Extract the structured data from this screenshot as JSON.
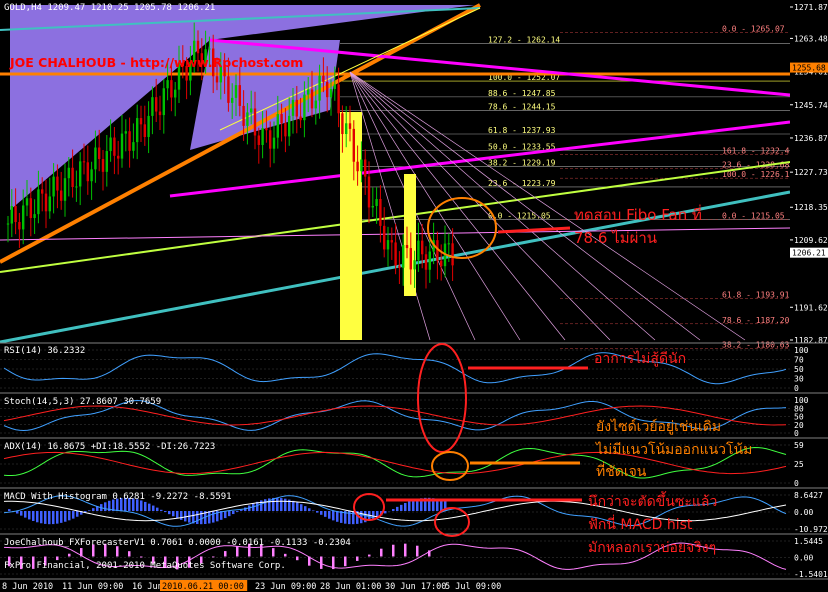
{
  "main": {
    "header": "GOLD,H4  1209.47 1210.25 1205.78 1206.21",
    "watermark": "JOE CHALHOUB - http://www.Rpchost.com",
    "yticks": [
      "1271.87",
      "1263.48",
      "1254.61",
      "1245.74",
      "1236.87",
      "1227.73",
      "1218.35",
      "1209.62",
      "1206.21",
      "1191.62",
      "1182.87"
    ],
    "price_tags": [
      "1255.68",
      "1206.21"
    ],
    "fibo_top": [
      {
        "pct": "127.2",
        "val": "1262.14"
      },
      {
        "pct": "100.0",
        "val": "1252.07"
      },
      {
        "pct": "88.6",
        "val": "1247.85"
      },
      {
        "pct": "78.6",
        "val": "1244.15"
      },
      {
        "pct": "61.8",
        "val": "1237.93"
      },
      {
        "pct": "50.0",
        "val": "1233.55"
      },
      {
        "pct": "38.2",
        "val": "1229.19"
      },
      {
        "pct": "23.6",
        "val": "1223.79"
      },
      {
        "pct": "0.0",
        "val": "1215.05"
      }
    ],
    "fibo_right": [
      {
        "pct": "0.0",
        "val": "1265.07"
      },
      {
        "pct": "161.8",
        "val": "1232.42"
      },
      {
        "pct": "23.6",
        "val": "1228.68"
      },
      {
        "pct": "100.0",
        "val": "1226.12"
      },
      {
        "pct": "0.0",
        "val": "1215.05"
      },
      {
        "pct": "61.8",
        "val": "1193.91"
      },
      {
        "pct": "78.6",
        "val": "1187.20"
      },
      {
        "pct": "38.2",
        "val": "1180.63"
      }
    ],
    "annotation": [
      "ทดสอบ Fibo Fan ที่",
      "78.6 ไม่ผ่าน"
    ],
    "colors": {
      "up": "#00c000",
      "down": "#e00000",
      "orange": "#ff8000",
      "magenta": "#ff00ff",
      "cyan": "#40c0c0",
      "yellow": "#ffff40"
    }
  },
  "rsi": {
    "label": "RSI(14) 36.2332",
    "ticks": [
      "100",
      "70",
      "50",
      "30",
      "0"
    ],
    "note": "อาการไม่สู้ดีนัก"
  },
  "stoch": {
    "label": "Stoch(14,5,3) 27.8607 30.7659",
    "ticks": [
      "100",
      "80",
      "50",
      "20",
      "0"
    ]
  },
  "adx": {
    "label": "ADX(14) 16.8675 +DI:18.5552 -DI:26.7223",
    "ticks": [
      "59",
      "25",
      "0"
    ]
  },
  "note_stoch_adx": [
    "ยังไซด์เวย์อยู่เช่นเดิม",
    "ไม่มีแนวโน้มออกแนวโน้ม",
    "ที่ชัดเจน"
  ],
  "macd": {
    "label": "MACD With Histogram 0.6281 -9.2272 -8.5591",
    "ticks": [
      "8.6427",
      "0.00",
      "-10.9727"
    ],
    "note": [
      "นึกว่าจะตัดขึ้นซะแล้ว",
      "ฟักนี่ MACD hist",
      "มักหลอกเราบ่อยจริงๆ"
    ]
  },
  "forecaster": {
    "label": "JoeChalhoub_FXForecasterV1 0.7061 0.0000 -0.0161 -0.1133 -0.2304",
    "copyright": "FxPro Financial, 2001-2010 MetaQuotes Software Corp.",
    "ticks": [
      "1.5445",
      "0.00",
      "-1.5401"
    ]
  },
  "xaxis": {
    "labels": [
      "8 Jun 2010",
      "11 Jun 09:00",
      "16 Jun",
      "2010.06.21 00:00",
      "23 Jun 09:00",
      "28 Jun 01:00",
      "30 Jun 17:00",
      "5 Jul 09:00"
    ]
  },
  "chart_data": {
    "type": "line",
    "title": "GOLD,H4",
    "symbol": "GOLD",
    "timeframe": "H4",
    "ohlc_last": {
      "open": 1209.47,
      "high": 1210.25,
      "low": 1205.78,
      "close": 1206.21
    },
    "ylim": [
      1182.87,
      1271.87
    ],
    "x": [
      "8 Jun 2010",
      "11 Jun 09:00",
      "16 Jun",
      "2010.06.21 00:00",
      "23 Jun 09:00",
      "28 Jun 01:00",
      "30 Jun 17:00",
      "5 Jul 09:00"
    ],
    "series": [
      {
        "name": "GOLD",
        "values": [
          1214,
          1226,
          1238,
          1261,
          1236,
          1252,
          1205,
          1206.21
        ]
      }
    ],
    "indicators": [
      {
        "name": "RSI(14)",
        "values": [
          36.2332
        ]
      },
      {
        "name": "Stoch(14,5,3)",
        "values": [
          27.8607,
          30.7659
        ]
      },
      {
        "name": "ADX(14)",
        "values": [
          16.8675,
          18.5552,
          26.7223
        ]
      },
      {
        "name": "MACD With Histogram",
        "values": [
          0.6281,
          -9.2272,
          -8.5591
        ]
      }
    ]
  }
}
